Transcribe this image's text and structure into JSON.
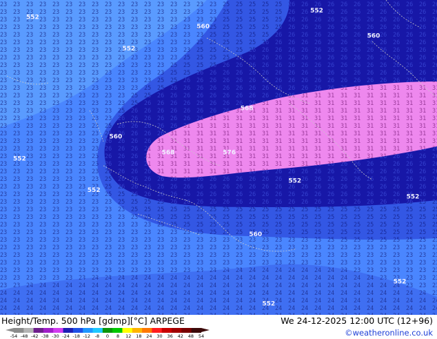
{
  "header": {
    "title": "Height/Temp. 500 hPa [gdmp][°C] ARPEGE",
    "valid_time": "We 24-12-2025 12:00 UTC (12+96)",
    "credit": "©weatheronline.co.uk"
  },
  "legend": {
    "unit": "°C",
    "ticks": [
      "-54",
      "-48",
      "-42",
      "-38",
      "-30",
      "-24",
      "-18",
      "-12",
      "-8",
      "0",
      "8",
      "12",
      "18",
      "24",
      "30",
      "36",
      "42",
      "48",
      "54"
    ],
    "colors": [
      "#8c8c8c",
      "#b4b4b4",
      "#6e1e8c",
      "#a01ec8",
      "#d23cf0",
      "#1e1eb4",
      "#1e50e6",
      "#1e96ff",
      "#1ec8ff",
      "#0a960a",
      "#00c800",
      "#ffff00",
      "#ffb400",
      "#ff7800",
      "#ff1e1e",
      "#c80000",
      "#a00000",
      "#780000",
      "#3c0a0a"
    ]
  },
  "map": {
    "contour_labels": [
      {
        "text": "552",
        "sx": 0.06,
        "sy": 0.06
      },
      {
        "text": "552",
        "sx": 0.28,
        "sy": 0.16
      },
      {
        "text": "552",
        "sx": 0.71,
        "sy": 0.04
      },
      {
        "text": "552",
        "sx": 0.03,
        "sy": 0.51
      },
      {
        "text": "552",
        "sx": 0.2,
        "sy": 0.61
      },
      {
        "text": "552",
        "sx": 0.66,
        "sy": 0.58
      },
      {
        "text": "552",
        "sx": 0.93,
        "sy": 0.63
      },
      {
        "text": "552",
        "sx": 0.9,
        "sy": 0.9
      },
      {
        "text": "552",
        "sx": 0.6,
        "sy": 0.97
      },
      {
        "text": "560",
        "sx": 0.45,
        "sy": 0.09
      },
      {
        "text": "560",
        "sx": 0.84,
        "sy": 0.12
      },
      {
        "text": "560",
        "sx": 0.25,
        "sy": 0.44
      },
      {
        "text": "560",
        "sx": 0.57,
        "sy": 0.75
      },
      {
        "text": "568",
        "sx": 0.55,
        "sy": 0.35
      },
      {
        "text": "568",
        "sx": 0.37,
        "sy": 0.49
      },
      {
        "text": "576",
        "sx": 0.51,
        "sy": 0.49
      }
    ]
  },
  "colors": {
    "band_dark": "#1717a7",
    "band_mid": "#3357e4",
    "band_light": "#4881ff",
    "band_lightest": "#5a9bff",
    "ridge_pink": "#ee88ee",
    "text_dark": "#10166e",
    "text_pink": "#6a1a6a",
    "coast": "#c8c8c8",
    "credit_blue": "#1e3fd6"
  }
}
